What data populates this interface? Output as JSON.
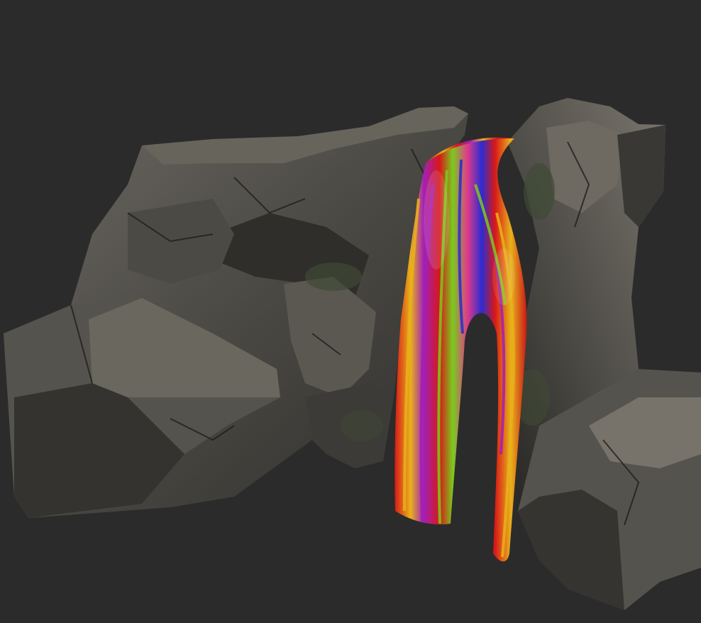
{
  "scene": {
    "background_color": "#2b2b2b",
    "objects": [
      {
        "name": "rock-formation",
        "material": "rock-stone"
      },
      {
        "name": "waterfall-ribbon",
        "material": "rainbow-stripes"
      }
    ],
    "rock_colors": {
      "base": "#4e4c47",
      "light": "#77736b",
      "dark": "#2e2d2a",
      "moss": "#3f4a36"
    },
    "ribbon_colors": [
      "#d81818",
      "#a21fb8",
      "#e8b21a",
      "#7acb1e",
      "#2b2bd0",
      "#e03a8a"
    ]
  }
}
